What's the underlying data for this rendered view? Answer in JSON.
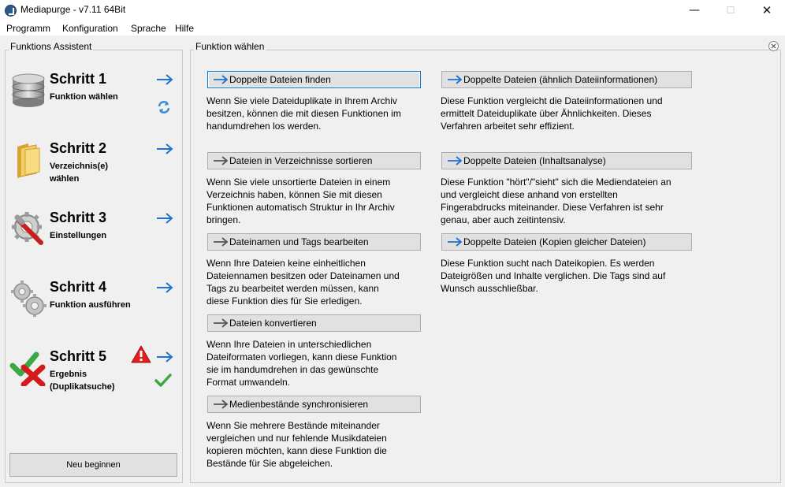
{
  "window": {
    "title": "Mediapurge - v7.11 64Bit",
    "controls": {
      "minimize": "—",
      "maximize": "☐",
      "close": "✕"
    }
  },
  "menu": [
    "Programm",
    "Konfiguration",
    "Sprache",
    "Hilfe"
  ],
  "assistant": {
    "caption": "Funktions Assistent",
    "steps": [
      {
        "title": "Schritt 1",
        "subtitle": "Funktion wählen",
        "icon": "database-icon"
      },
      {
        "title": "Schritt 2",
        "subtitle": "Verzeichnis(e) wählen",
        "icon": "folder-icon"
      },
      {
        "title": "Schritt 3",
        "subtitle": "Einstellungen",
        "icon": "settings-wrench-icon"
      },
      {
        "title": "Schritt 4",
        "subtitle": "Funktion ausführen",
        "icon": "gears-icon"
      },
      {
        "title": "Schritt 5",
        "subtitle": "Ergebnis (Duplikatsuche)",
        "icon": "check-cross-icon"
      }
    ],
    "new_button": "Neu beginnen"
  },
  "functions": {
    "caption": "Funktion wählen",
    "left": [
      {
        "label": "Doppelte Dateien finden",
        "desc": [
          "Wenn Sie viele Dateiduplikate in Ihrem Archiv",
          "besitzen, können die mit diesen Funktionen im",
          "handumdrehen los werden."
        ]
      },
      {
        "label": "Dateien in Verzeichnisse sortieren",
        "desc": [
          "Wenn Sie viele unsortierte Dateien in einem",
          "Verzeichnis  haben, können Sie mit diesen",
          "Funktionen automatisch Struktur in Ihr Archiv",
          "bringen."
        ]
      },
      {
        "label": "Dateinamen und Tags bearbeiten",
        "desc": [
          "Wenn Ihre Dateien keine einheitlichen",
          "Dateiennamen besitzen oder Dateinamen und",
          "Tags zu bearbeitet werden müssen, kann",
          "diese Funktion dies für Sie erledigen."
        ]
      },
      {
        "label": "Dateien konvertieren",
        "desc": [
          "Wenn Ihre Dateien in unterschiedlichen",
          "Dateiformaten vorliegen, kann diese Funktion",
          "sie im handumdrehen in das gewünschte",
          "Format umwandeln."
        ]
      },
      {
        "label": "Medienbestände synchronisieren",
        "desc": [
          "Wenn Sie mehrere Bestände miteinander",
          "vergleichen und nur fehlende Musikdateien",
          "kopieren möchten, kann diese Funktion die",
          "Bestände für Sie abgeleichen."
        ]
      }
    ],
    "right": [
      {
        "label": "Doppelte Dateien (ähnlich Dateiinformationen)",
        "desc": [
          "Diese Funktion vergleicht die Dateiinformationen und",
          "ermittelt Dateiduplikate über Ähnlichkeiten.  Dieses",
          "Verfahren arbeitet sehr effizient."
        ]
      },
      {
        "label": "Doppelte Dateien (Inhaltsanalyse)",
        "desc": [
          "Diese Funktion \"hört\"/\"sieht\" sich die Mediendateien an",
          "und vergleicht diese anhand von erstellten",
          "Fingerabdrucks miteinander.  Diese Verfahren ist sehr",
          "genau, aber auch zeitintensiv."
        ]
      },
      {
        "label": "Doppelte Dateien (Kopien gleicher Dateien)",
        "desc": [
          "Diese Funktion sucht nach Dateikopien.  Es werden",
          "Dateigrößen und Inhalte verglichen. Die Tags sind auf",
          "Wunsch ausschließbar."
        ]
      }
    ]
  },
  "colors": {
    "accent": "#1e73d2",
    "arrow_gray": "#555555",
    "button_bg": "#e1e1e1",
    "warning": "#e02020",
    "check_green": "#3aa845"
  }
}
